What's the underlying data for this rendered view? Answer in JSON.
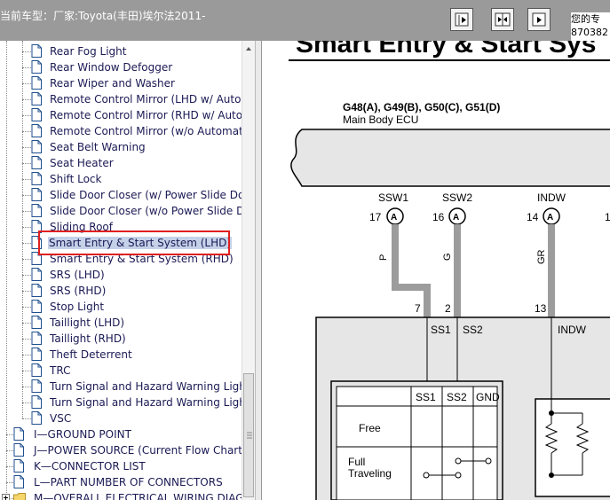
{
  "window": {
    "title": "当前车型：厂家:Toyota(丰田)埃尔法2011-",
    "right_text_line1": "您的专",
    "right_text_line2": "870382"
  },
  "toolbar": {
    "buttons": [
      "nav-prev-icon",
      "nav-split-icon",
      "nav-next-icon"
    ]
  },
  "tree": {
    "items": [
      "Rear Fog Light",
      "Rear Window Defogger",
      "Rear Wiper and Washer",
      "Remote Control Mirror (LHD w/ Autom",
      "Remote Control Mirror (RHD w/ Autor",
      "Remote Control Mirror (w/o Automatic",
      "Seat Belt Warning",
      "Seat Heater",
      "Shift Lock",
      "Slide Door Closer (w/ Power Slide Do",
      "Slide Door Closer (w/o Power Slide D",
      "Sliding Roof",
      "Smart Entry & Start System (LHD)",
      "Smart Entry & Start System (RHD)",
      "SRS (LHD)",
      "SRS (RHD)",
      "Stop Light",
      "Taillight (LHD)",
      "Taillight (RHD)",
      "Theft Deterrent",
      "TRC",
      "Turn Signal and Hazard Warning Light",
      "Turn Signal and Hazard Warning Light",
      "VSC"
    ],
    "selected_index": 12,
    "sections": [
      "I—GROUND POINT",
      "J—POWER SOURCE (Current Flow Chart)",
      "K—CONNECTOR LIST",
      "L—PART NUMBER OF CONNECTORS",
      "M—OVERALL ELECTRICAL WIRING DIAG"
    ]
  },
  "diagram": {
    "heading": "Smart Entry & Start Sys",
    "ecu_connectors": "G48(A), G49(B), G50(C), G51(D)",
    "ecu_name": "Main Body ECU",
    "pins": [
      {
        "name": "SSW1",
        "num": "17",
        "conn": "A",
        "wire": "P"
      },
      {
        "name": "SSW2",
        "num": "16",
        "conn": "A",
        "wire": "G"
      },
      {
        "name": "INDW",
        "num": "14",
        "conn": "A",
        "wire": "GR"
      }
    ],
    "lower_pins": [
      "7",
      "2",
      "13"
    ],
    "lower_labels": [
      "SS1",
      "SS2",
      "INDW"
    ],
    "switch_table": {
      "headers": [
        "SS1",
        "SS2",
        "GND"
      ],
      "rows": [
        "Free",
        "Full\nTraveling"
      ]
    },
    "row_full_line1": "Full",
    "row_full_line2": "Traveling",
    "edge_label": "1"
  }
}
